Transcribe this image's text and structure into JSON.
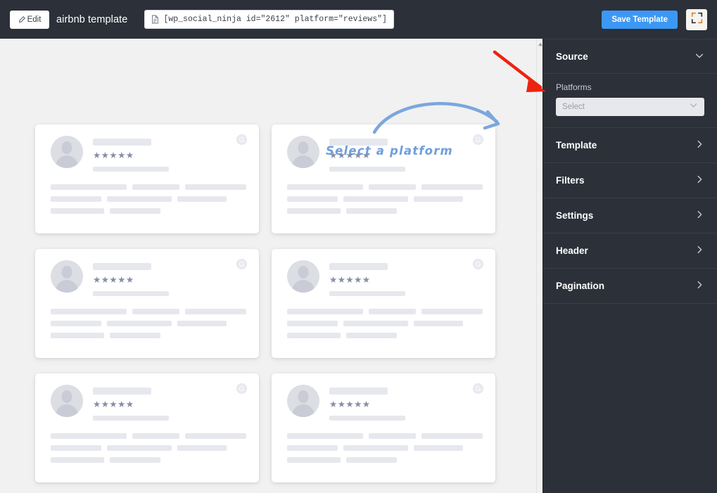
{
  "topbar": {
    "edit_label": "Edit",
    "edit_icon": "pencil-icon",
    "title": "airbnb template",
    "shortcode_icon": "document-icon",
    "shortcode": "[wp_social_ninja id=\"2612\" platform=\"reviews\"]",
    "save_label": "Save Template",
    "fullscreen_icon": "fullscreen-icon",
    "accent_color": "#3c98f5",
    "background_color": "#2b3039"
  },
  "annotation": {
    "label": "Select a platform",
    "arrow_icon": "curved-arrow-icon",
    "arrow_color": "#7ba7dd",
    "pointer_icon": "red-arrow-icon",
    "pointer_color": "#ee2211"
  },
  "canvas": {
    "background_color": "#f1f1f1",
    "scroll_up_icon": "scroll-up-arrow-icon"
  },
  "cards": [
    {
      "platform_icon": "google-g-icon",
      "rating": "★★★★★"
    },
    {
      "platform_icon": "google-g-icon",
      "rating": "★★★★★"
    },
    {
      "platform_icon": "google-g-icon",
      "rating": "★★★★★"
    },
    {
      "platform_icon": "google-g-icon",
      "rating": "★★★★★"
    },
    {
      "platform_icon": "google-g-icon",
      "rating": "★★★★★"
    },
    {
      "platform_icon": "google-g-icon",
      "rating": "★★★★★"
    }
  ],
  "sidebar": {
    "source": {
      "label": "Source",
      "expanded": true,
      "chevron_icon": "chevron-down-icon",
      "platforms_label": "Platforms",
      "platforms_value": "",
      "platforms_placeholder": "Select",
      "platforms_chevron_icon": "chevron-down-icon"
    },
    "sections": [
      {
        "label": "Template",
        "chevron_icon": "chevron-right-icon"
      },
      {
        "label": "Filters",
        "chevron_icon": "chevron-right-icon"
      },
      {
        "label": "Settings",
        "chevron_icon": "chevron-right-icon"
      },
      {
        "label": "Header",
        "chevron_icon": "chevron-right-icon"
      },
      {
        "label": "Pagination",
        "chevron_icon": "chevron-right-icon"
      }
    ]
  }
}
